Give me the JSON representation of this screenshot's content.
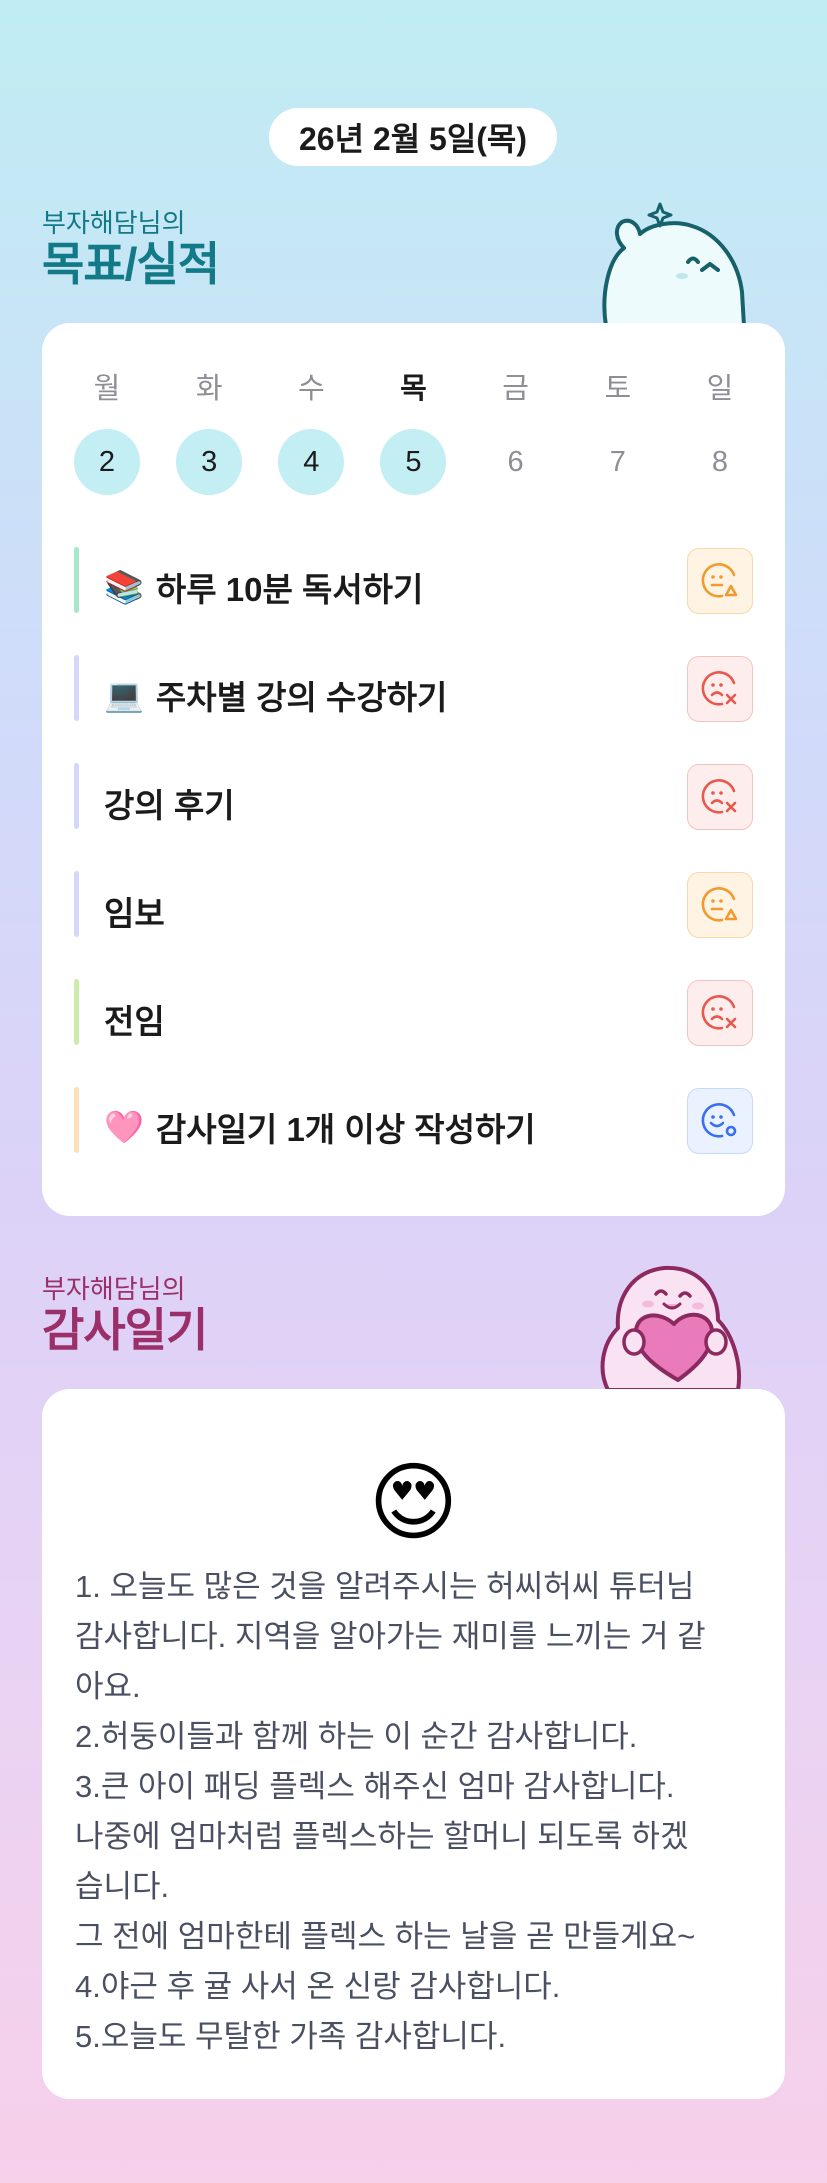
{
  "date_label": "26년 2월 5일(목)",
  "goals_section": {
    "owner": "부자해담님의",
    "title": "목표/실적"
  },
  "week": [
    {
      "name": "월",
      "num": "2",
      "done": true,
      "today": false
    },
    {
      "name": "화",
      "num": "3",
      "done": true,
      "today": false
    },
    {
      "name": "수",
      "num": "4",
      "done": true,
      "today": false
    },
    {
      "name": "목",
      "num": "5",
      "done": true,
      "today": true
    },
    {
      "name": "금",
      "num": "6",
      "done": false,
      "today": false
    },
    {
      "name": "토",
      "num": "7",
      "done": false,
      "today": false
    },
    {
      "name": "일",
      "num": "8",
      "done": false,
      "today": false
    }
  ],
  "goals": [
    {
      "emoji": "📚",
      "label": "하루 10분 독서하기",
      "bar_color": "#a6e8c9",
      "status": "partial",
      "status_icon": "face-triangle-icon"
    },
    {
      "emoji": "💻",
      "label": "주차별 강의 수강하기",
      "bar_color": "#d3d8fa",
      "status": "fail",
      "status_icon": "face-x-icon"
    },
    {
      "emoji": "",
      "label": "강의 후기",
      "bar_color": "#d3d8fa",
      "status": "fail",
      "status_icon": "face-x-icon"
    },
    {
      "emoji": "",
      "label": "임보",
      "bar_color": "#d3d8fa",
      "status": "partial",
      "status_icon": "face-triangle-icon"
    },
    {
      "emoji": "",
      "label": "전임",
      "bar_color": "#ccecac",
      "status": "fail",
      "status_icon": "face-x-icon"
    },
    {
      "emoji": "🩷",
      "label": "감사일기 1개 이상 작성하기",
      "bar_color": "#fde0b8",
      "status": "done",
      "status_icon": "face-circle-icon"
    }
  ],
  "status_colors": {
    "partial": "#f29a2e",
    "fail": "#e8584c",
    "done": "#3b6ff0"
  },
  "gratitude_section": {
    "owner": "부자해담님의",
    "title": "감사일기"
  },
  "diary": {
    "emoji": "😍",
    "text": "1. 오늘도 많은 것을 알려주시는 허씨허씨 튜터님\n감사합니다. 지역을 알아가는 재미를 느끼는 거 같\n아요.\n2.허둥이들과 함께 하는 이 순간 감사합니다.\n3.큰 아이 패딩 플렉스 해주신 엄마 감사합니다.\n나중에 엄마처럼 플렉스하는 할머니 되도록 하겠\n습니다.\n그 전에 엄마한테 플렉스 하는 날을 곧 만들게요~\n4.야근 후 귤 사서 온 신랑 감사합니다.\n5.오늘도 무탈한 가족 감사합니다."
  }
}
